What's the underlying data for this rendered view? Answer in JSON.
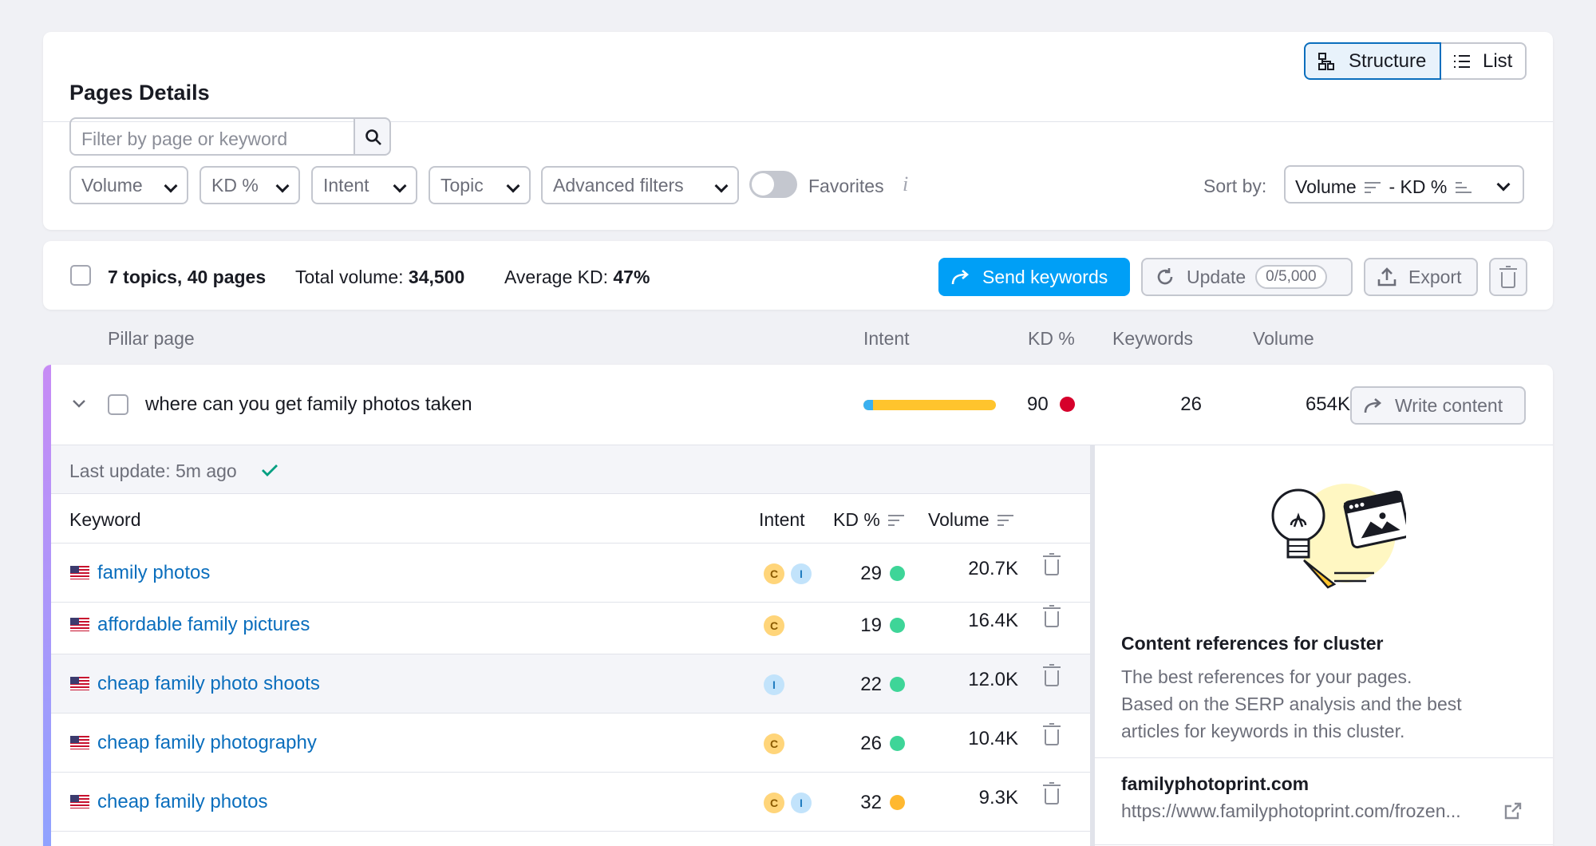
{
  "header": {
    "title": "Pages Details",
    "view_structure": "Structure",
    "view_list": "List"
  },
  "filters": {
    "search_placeholder": "Filter by page or keyword",
    "volume": "Volume",
    "kd": "KD %",
    "intent": "Intent",
    "topic": "Topic",
    "advanced": "Advanced filters",
    "favorites": "Favorites",
    "favorites_on": false,
    "sort_label": "Sort by:",
    "sort_primary": "Volume",
    "sort_sep": "- KD %"
  },
  "summary": {
    "counts": "7 topics, 40 pages",
    "total_volume_label": "Total volume:",
    "total_volume": "34,500",
    "avg_kd_label": "Average KD:",
    "avg_kd": "47%",
    "send_keywords": "Send keywords",
    "update": "Update",
    "update_quota": "0/5,000",
    "export": "Export"
  },
  "columns": {
    "pillar": "Pillar page",
    "intent": "Intent",
    "kd": "KD %",
    "keywords": "Keywords",
    "volume": "Volume"
  },
  "cluster": {
    "title": "where can you get family photos taken",
    "intent_informational_share": 0.07,
    "kd": "90",
    "kd_color": "#d6002b",
    "keywords": "26",
    "volume": "654K",
    "write_content": "Write content",
    "last_update": "Last update: 5m ago"
  },
  "keyword_table": {
    "headers": {
      "keyword": "Keyword",
      "intent": "Intent",
      "kd": "KD %",
      "volume": "Volume"
    },
    "rows": [
      {
        "keyword": "family photos",
        "intents": [
          "C",
          "I"
        ],
        "kd": "29",
        "kd_color": "#3ed598",
        "volume": "20.7K"
      },
      {
        "keyword": "affordable family pictures",
        "intents": [
          "C"
        ],
        "kd": "19",
        "kd_color": "#3ed598",
        "volume": "16.4K"
      },
      {
        "keyword": "cheap family photo shoots",
        "intents": [
          "I"
        ],
        "kd": "22",
        "kd_color": "#3ed598",
        "volume": "12.0K"
      },
      {
        "keyword": "cheap family photography",
        "intents": [
          "C"
        ],
        "kd": "26",
        "kd_color": "#3ed598",
        "volume": "10.4K"
      },
      {
        "keyword": "cheap family photos",
        "intents": [
          "C",
          "I"
        ],
        "kd": "32",
        "kd_color": "#ffb830",
        "volume": "9.3K"
      }
    ]
  },
  "side_panel": {
    "title": "Content references for cluster",
    "body_line1": "The best references for your pages.",
    "body_line2": "Based on the SERP analysis and the best",
    "body_line3": "articles for keywords in this cluster.",
    "site": "familyphotoprint.com",
    "url": "https://www.familyphotoprint.com/frozen..."
  },
  "colors": {
    "accent": "#009ff6",
    "link": "#0a6ebd",
    "background": "#f0f1f5"
  }
}
